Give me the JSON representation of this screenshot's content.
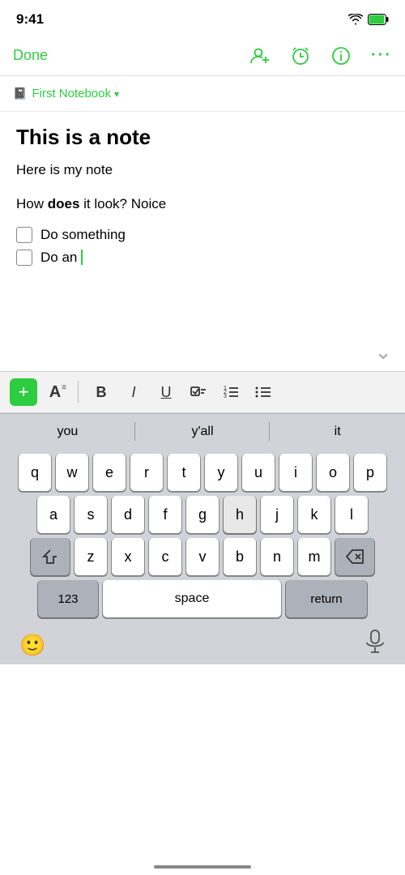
{
  "statusBar": {
    "time": "9:41"
  },
  "navBar": {
    "doneLabel": "Done",
    "addPersonTitle": "Add person",
    "reminderTitle": "Reminder",
    "infoTitle": "Info",
    "moreTitle": "More"
  },
  "notebookBar": {
    "name": "First Notebook",
    "chevron": "▾"
  },
  "noteContent": {
    "title": "This is a note",
    "line1": "Here is my note",
    "line2_pre": "How ",
    "line2_bold": "does",
    "line2_post": " it look? Noice",
    "checklist": [
      {
        "label": "Do something",
        "checked": false
      },
      {
        "label": "Do an",
        "checked": false,
        "cursor": true
      }
    ]
  },
  "formatToolbar": {
    "plusLabel": "+",
    "textStyleLabel": "A",
    "boldLabel": "B",
    "italicLabel": "I",
    "underlineLabel": "U",
    "checkboxLabel": "✓",
    "listLabel": "≡",
    "listOutlineLabel": "≡"
  },
  "autocomplete": {
    "items": [
      "you",
      "y'all",
      "it"
    ]
  },
  "keyboard": {
    "rows": [
      [
        "q",
        "w",
        "e",
        "r",
        "t",
        "y",
        "u",
        "i",
        "o",
        "p"
      ],
      [
        "a",
        "s",
        "d",
        "f",
        "g",
        "h",
        "j",
        "k",
        "l"
      ],
      [
        "z",
        "x",
        "c",
        "v",
        "b",
        "n",
        "m"
      ]
    ],
    "spaceLabel": "space",
    "returnLabel": "return",
    "numbersLabel": "123"
  },
  "bottomBar": {
    "emojiLabel": "🙂",
    "micLabel": "🎤"
  }
}
